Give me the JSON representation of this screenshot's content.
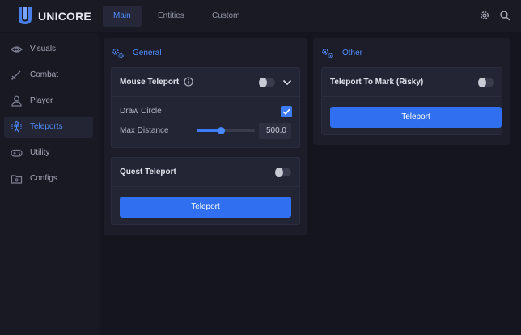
{
  "app": {
    "brand": "UNICORE",
    "accent": "#4f8dff",
    "button_color": "#2f6ff0"
  },
  "tabs": [
    {
      "label": "Main",
      "active": true
    },
    {
      "label": "Entities",
      "active": false
    },
    {
      "label": "Custom",
      "active": false
    }
  ],
  "top_icons": [
    "gear-icon",
    "search-icon"
  ],
  "sidebar": {
    "items": [
      {
        "label": "Visuals",
        "icon": "eye-icon",
        "active": false
      },
      {
        "label": "Combat",
        "icon": "sword-icon",
        "active": false
      },
      {
        "label": "Player",
        "icon": "user-icon",
        "active": false
      },
      {
        "label": "Teleports",
        "icon": "teleport-icon",
        "active": true
      },
      {
        "label": "Utility",
        "icon": "gamepad-icon",
        "active": false
      },
      {
        "label": "Configs",
        "icon": "folder-icon",
        "active": false
      }
    ]
  },
  "general": {
    "title": "General",
    "mouse_teleport": {
      "title": "Mouse Teleport",
      "enabled": false,
      "expanded": true,
      "draw_circle": {
        "label": "Draw Circle",
        "checked": true
      },
      "max_distance": {
        "label": "Max Distance",
        "value": "500.0",
        "fraction": 0.42
      }
    },
    "quest_teleport": {
      "title": "Quest Teleport",
      "enabled": false,
      "button_label": "Teleport"
    }
  },
  "other": {
    "title": "Other",
    "teleport_to_mark": {
      "title": "Teleport To Mark (Risky)",
      "enabled": false,
      "button_label": "Teleport"
    }
  }
}
